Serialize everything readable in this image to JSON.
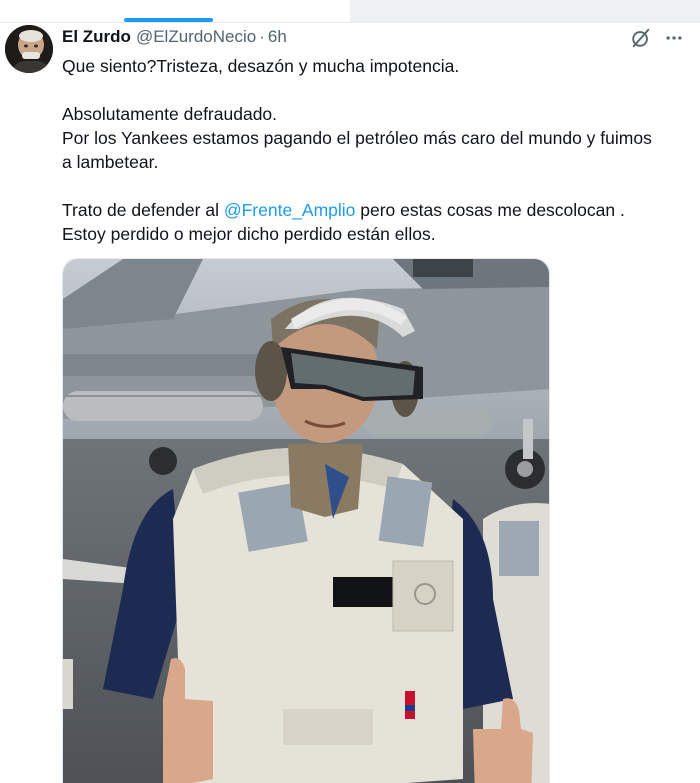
{
  "tweet": {
    "author_name": "El Zurdo",
    "author_handle": "@ElZurdoNecio",
    "separator": "·",
    "time": "6h",
    "lines": {
      "l1": "Que siento?Tristeza, desazón y mucha impotencia.",
      "l2": "Absolutamente defraudado.",
      "l3": "Por los Yankees estamos pagando el petróleo más caro del mundo y fuimos",
      "l4": "a lambetear.",
      "l5_pre": "Trato de defender al ",
      "l5_mention": "@Frente_Amplio",
      "l5_post": " pero estas cosas me descolocan .",
      "l6": "Estoy perdido o mejor dicho perdido están ellos."
    }
  },
  "icons": {
    "grok": "grok-icon",
    "more": "more-horizontal-icon",
    "avatar": "avatar"
  },
  "colors": {
    "accent": "#1d9bf0",
    "text": "#0f1419",
    "secondary": "#536471"
  }
}
